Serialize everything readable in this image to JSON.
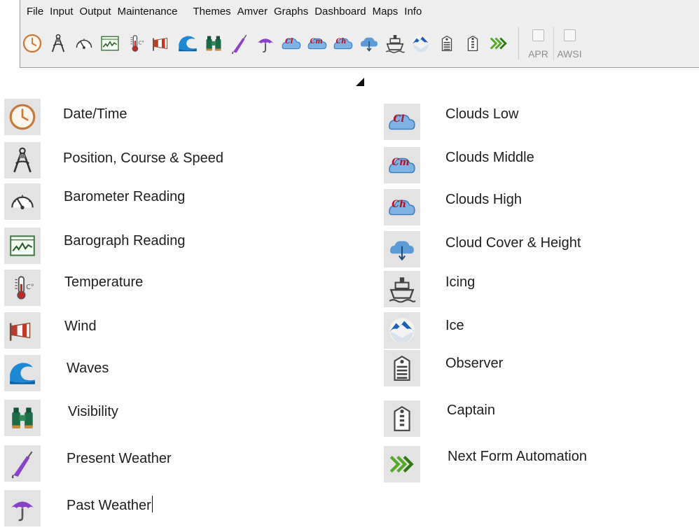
{
  "menu": [
    "File",
    "Input",
    "Output",
    "Maintenance",
    "Themes",
    "Amver",
    "Graphs",
    "Dashboard",
    "Maps",
    "Info"
  ],
  "toolbar": {
    "icons": [
      "clock-icon",
      "compass-icon",
      "barometer-icon",
      "barograph-icon",
      "thermometer-icon",
      "windsock-icon",
      "wave-icon",
      "binoculars-icon",
      "umbrella-closed-icon",
      "umbrella-icon",
      "cloud-cl-icon",
      "cloud-cm-icon",
      "cloud-ch-icon",
      "cloud-arrow-icon",
      "ship-icon",
      "ice-icon",
      "observer-icon",
      "captain-icon",
      "double-chevron-icon"
    ],
    "checkboxes": [
      {
        "label": "APR"
      },
      {
        "label": "AWSI"
      }
    ]
  },
  "legend": {
    "left": [
      {
        "label": "Date/Time",
        "icon": "clock-icon"
      },
      {
        "label": "Position, Course & Speed",
        "icon": "compass-icon"
      },
      {
        "label": "Barometer Reading",
        "icon": "barometer-icon"
      },
      {
        "label": "Barograph Reading",
        "icon": "barograph-icon"
      },
      {
        "label": "Temperature",
        "icon": "thermometer-icon"
      },
      {
        "label": "Wind",
        "icon": "windsock-icon"
      },
      {
        "label": "Waves",
        "icon": "wave-icon"
      },
      {
        "label": "Visibility",
        "icon": "binoculars-icon"
      },
      {
        "label": "Present Weather",
        "icon": "umbrella-closed-icon"
      },
      {
        "label": "Past Weather",
        "icon": "umbrella-icon"
      }
    ],
    "right": [
      {
        "label": "Clouds Low",
        "icon": "cloud-cl-icon"
      },
      {
        "label": "Clouds Middle",
        "icon": "cloud-cm-icon"
      },
      {
        "label": "Clouds High",
        "icon": "cloud-ch-icon"
      },
      {
        "label": "Cloud Cover & Height",
        "icon": "cloud-arrow-icon"
      },
      {
        "label": "Icing",
        "icon": "ship-icon"
      },
      {
        "label": "Ice",
        "icon": "ice-icon"
      },
      {
        "label": "Observer",
        "icon": "observer-icon"
      },
      {
        "label": "Captain",
        "icon": "captain-icon"
      },
      {
        "label": "Next Form Automation",
        "icon": "double-chevron-icon"
      }
    ]
  },
  "colors": {
    "clock": "#c8793a",
    "wave": "#1e88d2",
    "binoculars": "#1e6b4a",
    "umbrella": "#8a43c8",
    "cloud": "#7fb3e3",
    "cloud_text": "#b0122a",
    "ice": "#1b5fb8",
    "chevron": "#55a82a"
  }
}
